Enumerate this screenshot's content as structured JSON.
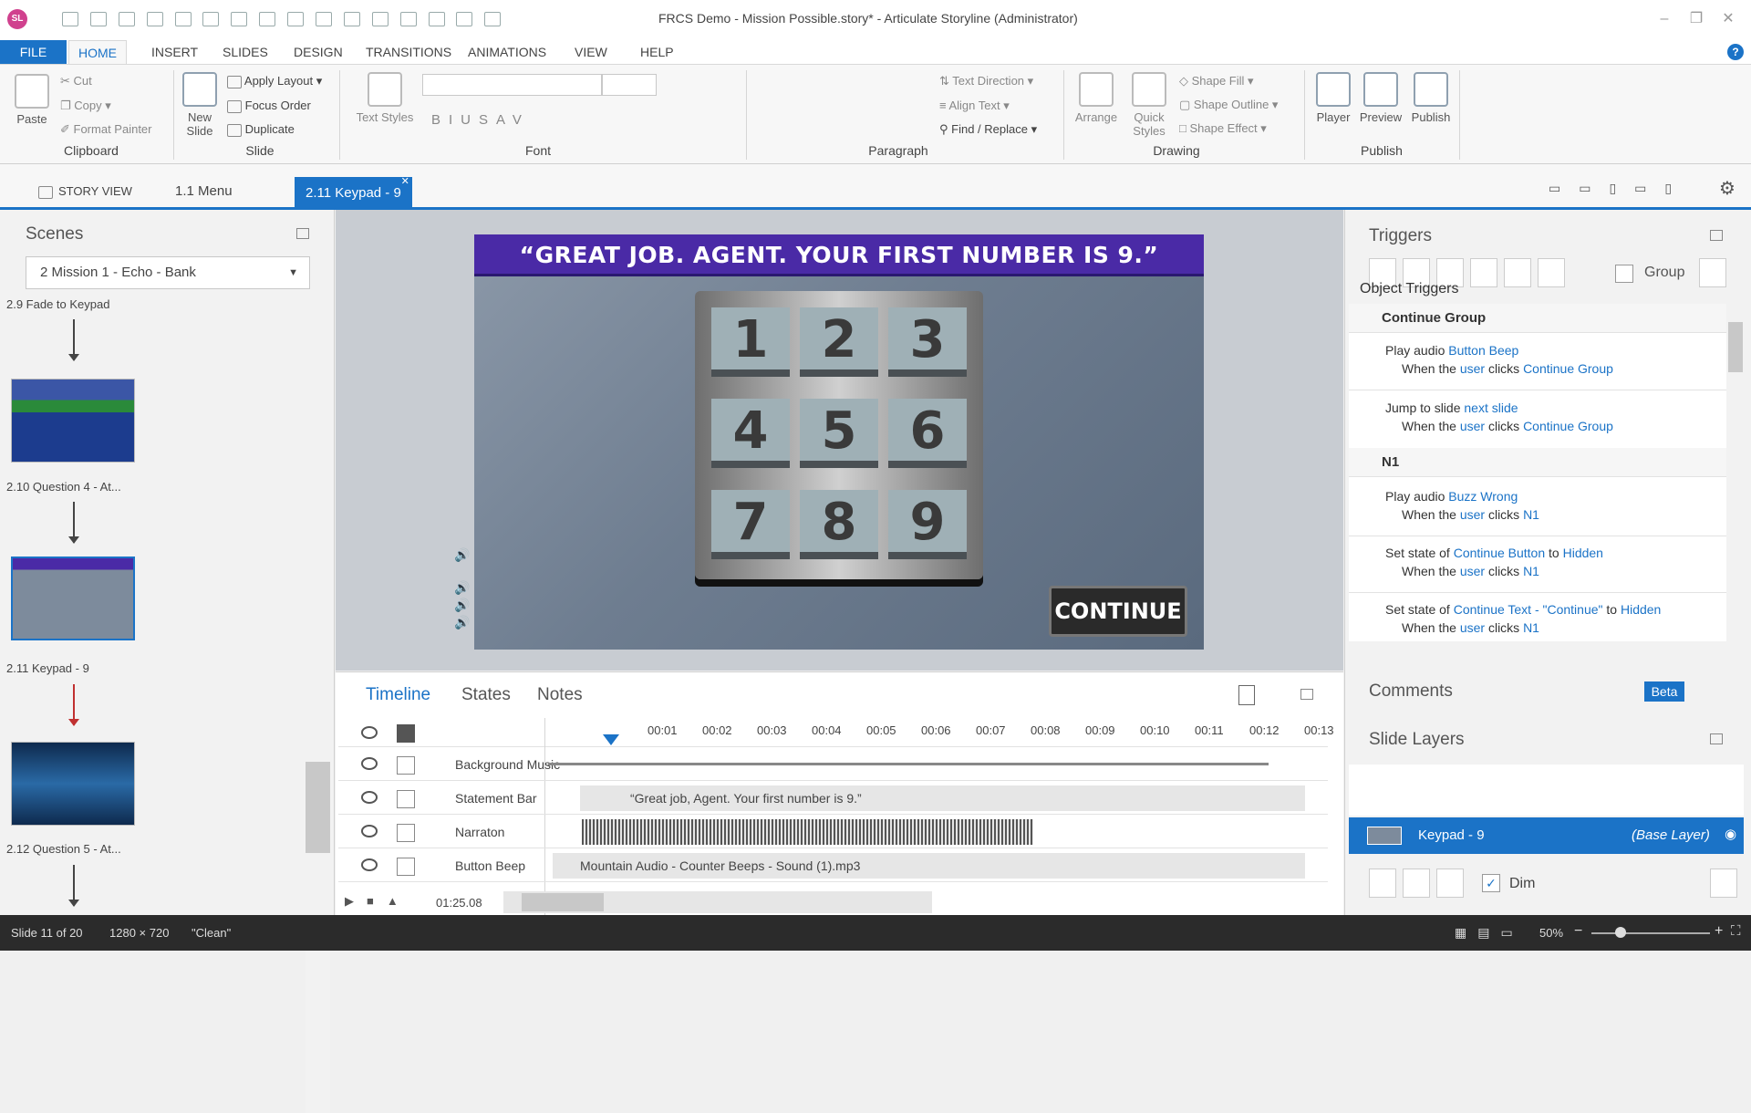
{
  "window": {
    "title": "FRCS Demo - Mission Possible.story* - Articulate Storyline (Administrator)",
    "logo": "SL"
  },
  "menu": [
    "FILE",
    "HOME",
    "INSERT",
    "SLIDES",
    "DESIGN",
    "TRANSITIONS",
    "ANIMATIONS",
    "VIEW",
    "HELP"
  ],
  "ribbon": {
    "clipboard": {
      "label": "Clipboard",
      "paste": "Paste",
      "cut": "Cut",
      "copy": "Copy",
      "format_painter": "Format Painter"
    },
    "slide": {
      "label": "Slide",
      "new_slide": "New Slide",
      "apply_layout": "Apply Layout",
      "focus_order": "Focus Order",
      "duplicate": "Duplicate"
    },
    "font": {
      "label": "Font",
      "text_styles": "Text Styles"
    },
    "paragraph": {
      "label": "Paragraph",
      "text_direction": "Text Direction",
      "align_text": "Align Text",
      "find_replace": "Find / Replace"
    },
    "drawing": {
      "label": "Drawing",
      "arrange": "Arrange",
      "quick_styles": "Quick Styles",
      "shape_fill": "Shape Fill",
      "shape_outline": "Shape Outline",
      "shape_effect": "Shape Effect"
    },
    "publish": {
      "label": "Publish",
      "player": "Player",
      "preview": "Preview",
      "publish": "Publish"
    }
  },
  "tabs": {
    "story_view": "STORY VIEW",
    "menu": "1.1 Menu",
    "keypad": "2.11 Keypad - 9"
  },
  "scenes": {
    "title": "Scenes",
    "selected_scene": "2 Mission 1 - Echo - Bank",
    "slides": [
      {
        "label": "2.9 Fade to Keypad"
      },
      {
        "label": "2.10 Question 4 - At..."
      },
      {
        "label": "2.11 Keypad - 9"
      },
      {
        "label": "2.12 Question 5 - At..."
      }
    ]
  },
  "slide": {
    "banner": "“GREAT JOB. AGENT. YOUR FIRST NUMBER IS 9.”",
    "keys": [
      "1",
      "2",
      "3",
      "4",
      "5",
      "6",
      "7",
      "8",
      "9"
    ],
    "continue": "CONTINUE"
  },
  "timeline": {
    "tabs": [
      "Timeline",
      "States",
      "Notes"
    ],
    "ticks": [
      "00:01",
      "00:02",
      "00:03",
      "00:04",
      "00:05",
      "00:06",
      "00:07",
      "00:08",
      "00:09",
      "00:10",
      "00:11",
      "00:12",
      "00:13"
    ],
    "rows": [
      {
        "name": "Background Music",
        "content": ""
      },
      {
        "name": "Statement Bar",
        "content": "“Great job, Agent. Your first number is 9.”"
      },
      {
        "name": "Narraton",
        "content": ""
      },
      {
        "name": "Button Beep",
        "content": "Mountain Audio - Counter Beeps - Sound (1).mp3"
      }
    ],
    "duration": "01:25.08"
  },
  "triggers": {
    "title": "Triggers",
    "group": "Group",
    "object_triggers": "Object Triggers",
    "groups": [
      {
        "name": "Continue Group",
        "items": [
          {
            "a_pre": "Play audio ",
            "a_obj": "Button Beep",
            "a_mid": "",
            "a_obj2": "",
            "b_pre": "When the ",
            "b_user": "user",
            "b_mid": " clicks ",
            "b_obj": "Continue Group"
          },
          {
            "a_pre": "Jump to slide ",
            "a_obj": "next slide",
            "a_mid": "",
            "a_obj2": "",
            "b_pre": "When the ",
            "b_user": "user",
            "b_mid": " clicks ",
            "b_obj": "Continue Group"
          }
        ]
      },
      {
        "name": "N1",
        "items": [
          {
            "a_pre": "Play audio ",
            "a_obj": "Buzz Wrong",
            "a_mid": "",
            "a_obj2": "",
            "b_pre": "When the ",
            "b_user": "user",
            "b_mid": " clicks ",
            "b_obj": "N1"
          },
          {
            "a_pre": "Set state of ",
            "a_obj": "Continue Button",
            "a_mid": " to ",
            "a_obj2": "Hidden",
            "b_pre": "When the ",
            "b_user": "user",
            "b_mid": " clicks ",
            "b_obj": "N1"
          },
          {
            "a_pre": "Set state of ",
            "a_obj": "Continue Text - \"Continue\"",
            "a_mid": " to ",
            "a_obj2": "Hidden",
            "b_pre": "When the ",
            "b_user": "user",
            "b_mid": " clicks ",
            "b_obj": "N1"
          }
        ]
      }
    ]
  },
  "comments": {
    "title": "Comments",
    "badge": "Beta"
  },
  "layers": {
    "title": "Slide Layers",
    "base_name": "Keypad - 9",
    "base_tag": "(Base Layer)",
    "dim": "Dim"
  },
  "status": {
    "slide": "Slide 11 of 20",
    "size": "1280 × 720",
    "theme": "\"Clean\"",
    "zoom": "50%"
  },
  "colors": {
    "accent": "#1b73c7",
    "banner": "#4a2aa6"
  }
}
